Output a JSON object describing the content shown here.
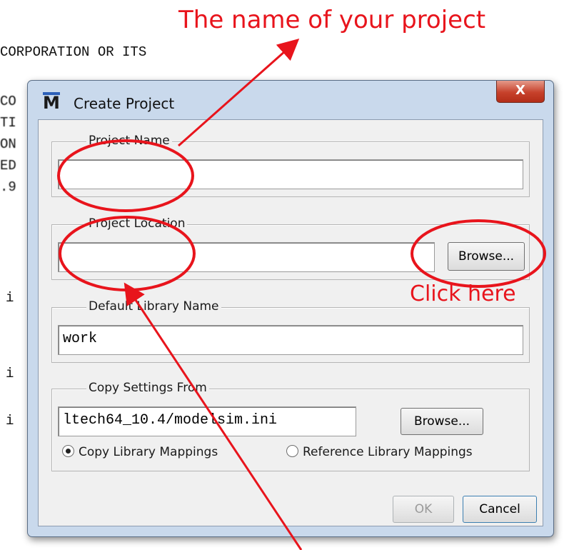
{
  "annotations": {
    "project_name_note": "The name of your project",
    "browse_note": "Click here"
  },
  "background_text": {
    "line1": "CORPORATION OR ITS",
    "left_column": [
      "CO",
      "TI",
      "ON",
      "ED",
      ".9"
    ],
    "lower_column": [
      "i",
      "i",
      "i"
    ]
  },
  "dialog": {
    "title": "Create Project",
    "close_label": "X",
    "project_name": {
      "label": "Project Name",
      "value": ""
    },
    "project_location": {
      "label": "Project Location",
      "value": "",
      "browse_label": "Browse..."
    },
    "default_library": {
      "label": "Default Library Name",
      "value": "work"
    },
    "copy_settings": {
      "label": "Copy Settings From",
      "value": "ltech64_10.4/modelsim.ini",
      "browse_label": "Browse...",
      "options": [
        {
          "label": "Copy Library Mappings",
          "selected": true
        },
        {
          "label": "Reference Library Mappings",
          "selected": false
        }
      ]
    },
    "ok_label": "OK",
    "cancel_label": "Cancel"
  },
  "colors": {
    "annotation": "#e8141c",
    "dialog_frame": "#c9d9ec",
    "client_bg": "#f0f0f0"
  }
}
